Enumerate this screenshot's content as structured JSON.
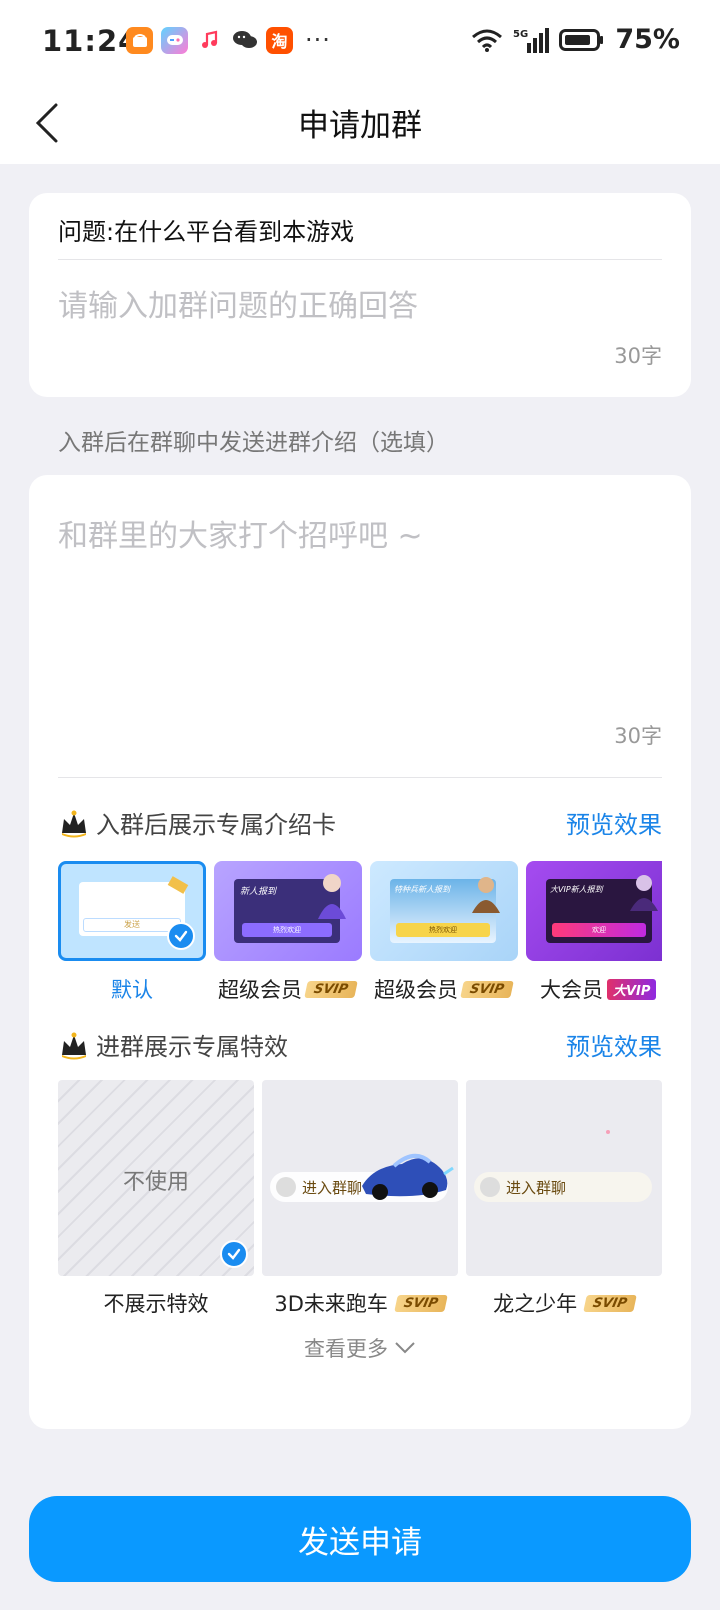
{
  "status_bar": {
    "time": "11:24",
    "battery_percent": "75%",
    "network": "5G",
    "more": "···",
    "app_icons": [
      "taobao-gift-icon",
      "game-center-icon",
      "music-icon",
      "wechat-icon",
      "taobao-icon"
    ]
  },
  "header": {
    "title": "申请加群"
  },
  "question": {
    "text": "问题:在什么平台看到本游戏",
    "answer_placeholder": "请输入加群问题的正确回答",
    "counter": "30字"
  },
  "intro": {
    "label": "入群后在群聊中发送进群介绍（选填）",
    "placeholder": "和群里的大家打个招呼吧 ~",
    "counter": "30字"
  },
  "intro_card_section": {
    "title": "入群后展示专属介绍卡",
    "preview": "预览效果",
    "cards": [
      {
        "label": "默认",
        "badge": "",
        "selected": true,
        "caption": "",
        "button": "发送"
      },
      {
        "label": "超级会员",
        "badge": "SVIP",
        "caption": "新人报到",
        "button": "热烈欢迎"
      },
      {
        "label": "超级会员",
        "badge": "SVIP",
        "caption": "特种兵新人报到",
        "button": "热烈欢迎"
      },
      {
        "label": "大会员",
        "badge": "大VIP",
        "caption": "大VIP新人报到",
        "button": "欢迎"
      }
    ]
  },
  "effect_section": {
    "title": "进群展示专属特效",
    "preview": "预览效果",
    "effects": [
      {
        "label": "不展示特效",
        "tile_text": "不使用",
        "badge": "",
        "selected": true
      },
      {
        "label": "3D未来跑车",
        "pill": "进入群聊",
        "badge": "SVIP"
      },
      {
        "label": "龙之少年",
        "pill": "进入群聊",
        "badge": "SVIP"
      }
    ],
    "see_more": "查看更多"
  },
  "submit": {
    "label": "发送申请"
  },
  "colors": {
    "primary": "#0a99ff",
    "link": "#1a84e8",
    "background": "#f0f0f5"
  }
}
